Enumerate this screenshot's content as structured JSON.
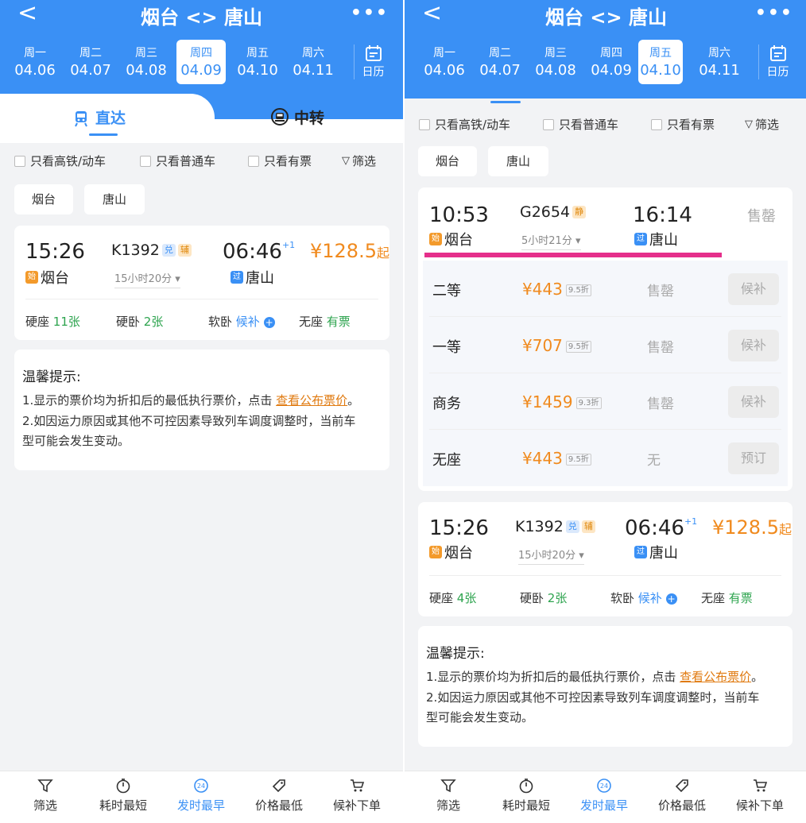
{
  "header": {
    "title": "烟台 <> 唐山",
    "back": "<",
    "more": "•••"
  },
  "dates": [
    {
      "weekday": "周一",
      "date": "04.06"
    },
    {
      "weekday": "周二",
      "date": "04.07"
    },
    {
      "weekday": "周三",
      "date": "04.08"
    },
    {
      "weekday": "周四",
      "date": "04.09"
    },
    {
      "weekday": "周五",
      "date": "04.10"
    },
    {
      "weekday": "周六",
      "date": "04.11"
    }
  ],
  "calendar_label": "日历",
  "left_selected_date": "04.09",
  "right_selected_date": "04.10",
  "tabs": {
    "direct": "直达",
    "transfer": "中转"
  },
  "filters": {
    "high_speed": "只看高铁/动车",
    "normal": "只看普通车",
    "available": "只看有票",
    "filter": "筛选"
  },
  "stations": {
    "from": "烟台",
    "to": "唐山"
  },
  "badges": {
    "start": "始",
    "pass": "过"
  },
  "left_train": {
    "depart": "15:26",
    "train_no": "K1392",
    "tag1": "兑",
    "tag2": "辅",
    "arrive": "06:46",
    "day_offset": "+1",
    "duration": "15小时20分",
    "price": "¥128.5",
    "price_suffix": "起",
    "seats": [
      {
        "name": "硬座",
        "value": "11张"
      },
      {
        "name": "硬卧",
        "value": "2张"
      },
      {
        "name": "软卧",
        "value": "候补"
      },
      {
        "name": "无座",
        "value": "有票"
      }
    ]
  },
  "right_g_train": {
    "depart": "10:53",
    "train_no": "G2654",
    "tag": "静",
    "arrive": "16:14",
    "duration": "5小时21分",
    "status": "售罄",
    "classes": [
      {
        "name": "二等",
        "price": "¥443",
        "discount": "9.5折",
        "status": "售罄",
        "action": "候补"
      },
      {
        "name": "一等",
        "price": "¥707",
        "discount": "9.5折",
        "status": "售罄",
        "action": "候补"
      },
      {
        "name": "商务",
        "price": "¥1459",
        "discount": "9.3折",
        "status": "售罄",
        "action": "候补"
      },
      {
        "name": "无座",
        "price": "¥443",
        "discount": "9.5折",
        "status": "无",
        "action": "预订"
      }
    ]
  },
  "right_k_train": {
    "depart": "15:26",
    "train_no": "K1392",
    "tag1": "兑",
    "tag2": "辅",
    "arrive": "06:46",
    "day_offset": "+1",
    "duration": "15小时20分",
    "price": "¥128.5",
    "price_suffix": "起",
    "seats": [
      {
        "name": "硬座",
        "value": "4张"
      },
      {
        "name": "硬卧",
        "value": "2张"
      },
      {
        "name": "软卧",
        "value": "候补"
      },
      {
        "name": "无座",
        "value": "有票"
      }
    ]
  },
  "tips": {
    "heading": "温馨提示:",
    "line1_prefix": "1.显示的票价均为折扣后的最低执行票价，点击 ",
    "line1_link": "查看公布票价",
    "line1_suffix": "。",
    "line2a": "2.如因运力原因或其他不可控因素导致列车调度调整时，当前车",
    "line2b": "型可能会发生变动。"
  },
  "bottom_nav": [
    {
      "label": "筛选",
      "icon": "filter-icon"
    },
    {
      "label": "耗时最短",
      "icon": "timer-icon"
    },
    {
      "label": "发时最早",
      "icon": "clock-24-icon"
    },
    {
      "label": "价格最低",
      "icon": "price-tag-icon"
    },
    {
      "label": "候补下单",
      "icon": "cart-icon"
    }
  ],
  "colors": {
    "primary": "#3a90f5",
    "price": "#f08a1e",
    "available": "#2ea44f",
    "highlight": "#e52f8b"
  }
}
